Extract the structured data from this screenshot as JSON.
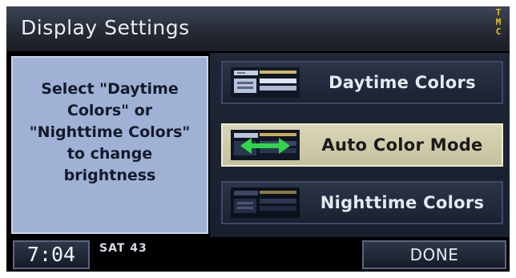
{
  "header": {
    "title": "Display Settings",
    "status_badge": [
      "T",
      "M",
      "C"
    ]
  },
  "instructions": {
    "lines": [
      "Select \"Daytime",
      "Colors\" or",
      "\"Nighttime Colors\"",
      "to change",
      "brightness"
    ]
  },
  "options": [
    {
      "label": "Daytime Colors",
      "icon": "daytime-colors-thumbnail",
      "selected": false
    },
    {
      "label": "Auto Color Mode",
      "icon": "auto-color-mode-thumbnail",
      "selected": true
    },
    {
      "label": "Nighttime Colors",
      "icon": "nighttime-colors-thumbnail",
      "selected": false
    }
  ],
  "footer": {
    "time": "7:04",
    "day_temp": "SAT 43",
    "done_label": "DONE"
  },
  "colors": {
    "selected_bg": "#d9d6b8",
    "panel_bg": "#9fb2d6",
    "tmc_yellow": "#e8c21a",
    "arrow_green": "#2fd64a"
  }
}
